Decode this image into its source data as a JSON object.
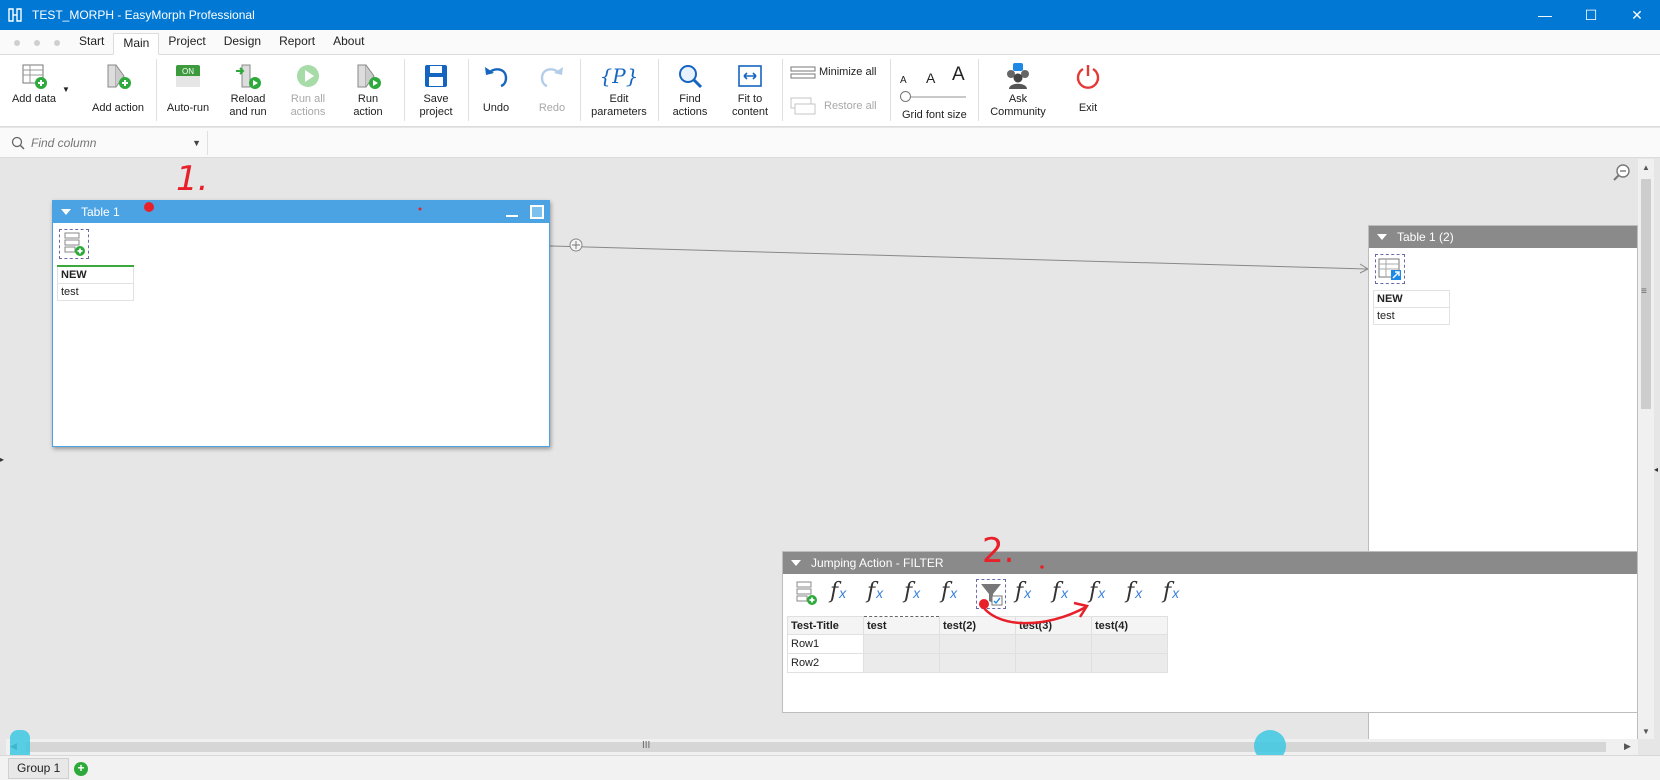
{
  "window": {
    "title": "TEST_MORPH - EasyMorph Professional",
    "minimize": "—",
    "maximize": "☐",
    "close": "✕"
  },
  "menu": {
    "tabs": [
      "Start",
      "Main",
      "Project",
      "Design",
      "Report",
      "About"
    ],
    "active": "Main"
  },
  "ribbon": {
    "add_data": "Add data",
    "add_action": "Add action",
    "auto_run": "Auto-run",
    "auto_run_on": "ON",
    "reload_and_run": [
      "Reload",
      "and run"
    ],
    "run_all_actions": [
      "Run all",
      "actions"
    ],
    "run_action": [
      "Run",
      "action"
    ],
    "save_project": [
      "Save",
      "project"
    ],
    "undo": "Undo",
    "redo": "Redo",
    "edit_parameters": [
      "Edit",
      "parameters"
    ],
    "edit_parameters_icon_text": "{P}",
    "find_actions": [
      "Find",
      "actions"
    ],
    "fit_to_content": [
      "Fit to",
      "content"
    ],
    "minimize_all": "Minimize all",
    "restore_all": "Restore all",
    "grid_font_size": "Grid font size",
    "font_small": "A",
    "font_medium": "A",
    "font_large": "A",
    "ask_community": [
      "Ask",
      "Community"
    ],
    "exit": "Exit"
  },
  "find_column": {
    "placeholder": "Find column"
  },
  "table1": {
    "title": "Table 1",
    "column": "NEW",
    "rows": [
      "test"
    ]
  },
  "table1_2": {
    "title": "Table 1 (2)",
    "column": "NEW",
    "rows": [
      "test"
    ]
  },
  "jumping_action": {
    "title": "Jumping Action - FILTER",
    "fx_label": "f",
    "fx_sub": "x",
    "columns": [
      "Test-Title",
      "test",
      "test(2)",
      "test(3)",
      "test(4)"
    ],
    "rows": [
      {
        "label": "Row1"
      },
      {
        "label": "Row2"
      }
    ]
  },
  "annotations": {
    "one": "1.",
    "two": "2."
  },
  "group_tab": "Group 1",
  "scroll_grip": "III",
  "colors": {
    "titlebar": "#0078d4",
    "table_header_blue": "#4ba3e3",
    "table_header_gray": "#8a8a8a",
    "annotation_red": "#e8202a",
    "annotation_cyan": "#3cc8e0"
  }
}
